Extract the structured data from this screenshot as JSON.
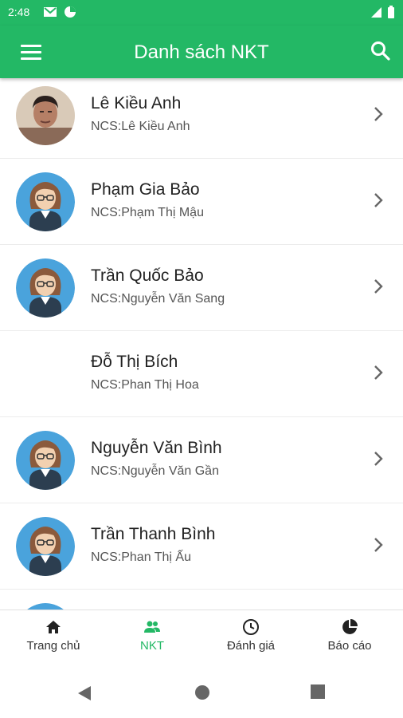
{
  "status_bar": {
    "time": "2:48"
  },
  "app_bar": {
    "title": "Danh sách NKT"
  },
  "people": [
    {
      "name": "Lê Kiều Anh",
      "ncs": "NCS:Lê Kiều Anh",
      "avatar": "photo"
    },
    {
      "name": "Phạm Gia Bảo",
      "ncs": "NCS:Phạm Thị Mậu",
      "avatar": "default"
    },
    {
      "name": "Trần Quốc Bảo",
      "ncs": "NCS:Nguyễn Văn Sang",
      "avatar": "default"
    },
    {
      "name": "Đỗ Thị Bích",
      "ncs": "NCS:Phan Thị Hoa",
      "avatar": "none"
    },
    {
      "name": "Nguyễn Văn Bình",
      "ncs": "NCS:Nguyễn Văn Gần",
      "avatar": "default"
    },
    {
      "name": "Trần Thanh Bình",
      "ncs": "NCS:Phan Thị Ấu",
      "avatar": "default"
    }
  ],
  "bottom_nav": {
    "home": "Trang chủ",
    "nkt": "NKT",
    "rating": "Đánh giá",
    "report": "Báo cáo"
  },
  "colors": {
    "accent": "#23b865",
    "avatar_bg": "#4aa3dc"
  }
}
